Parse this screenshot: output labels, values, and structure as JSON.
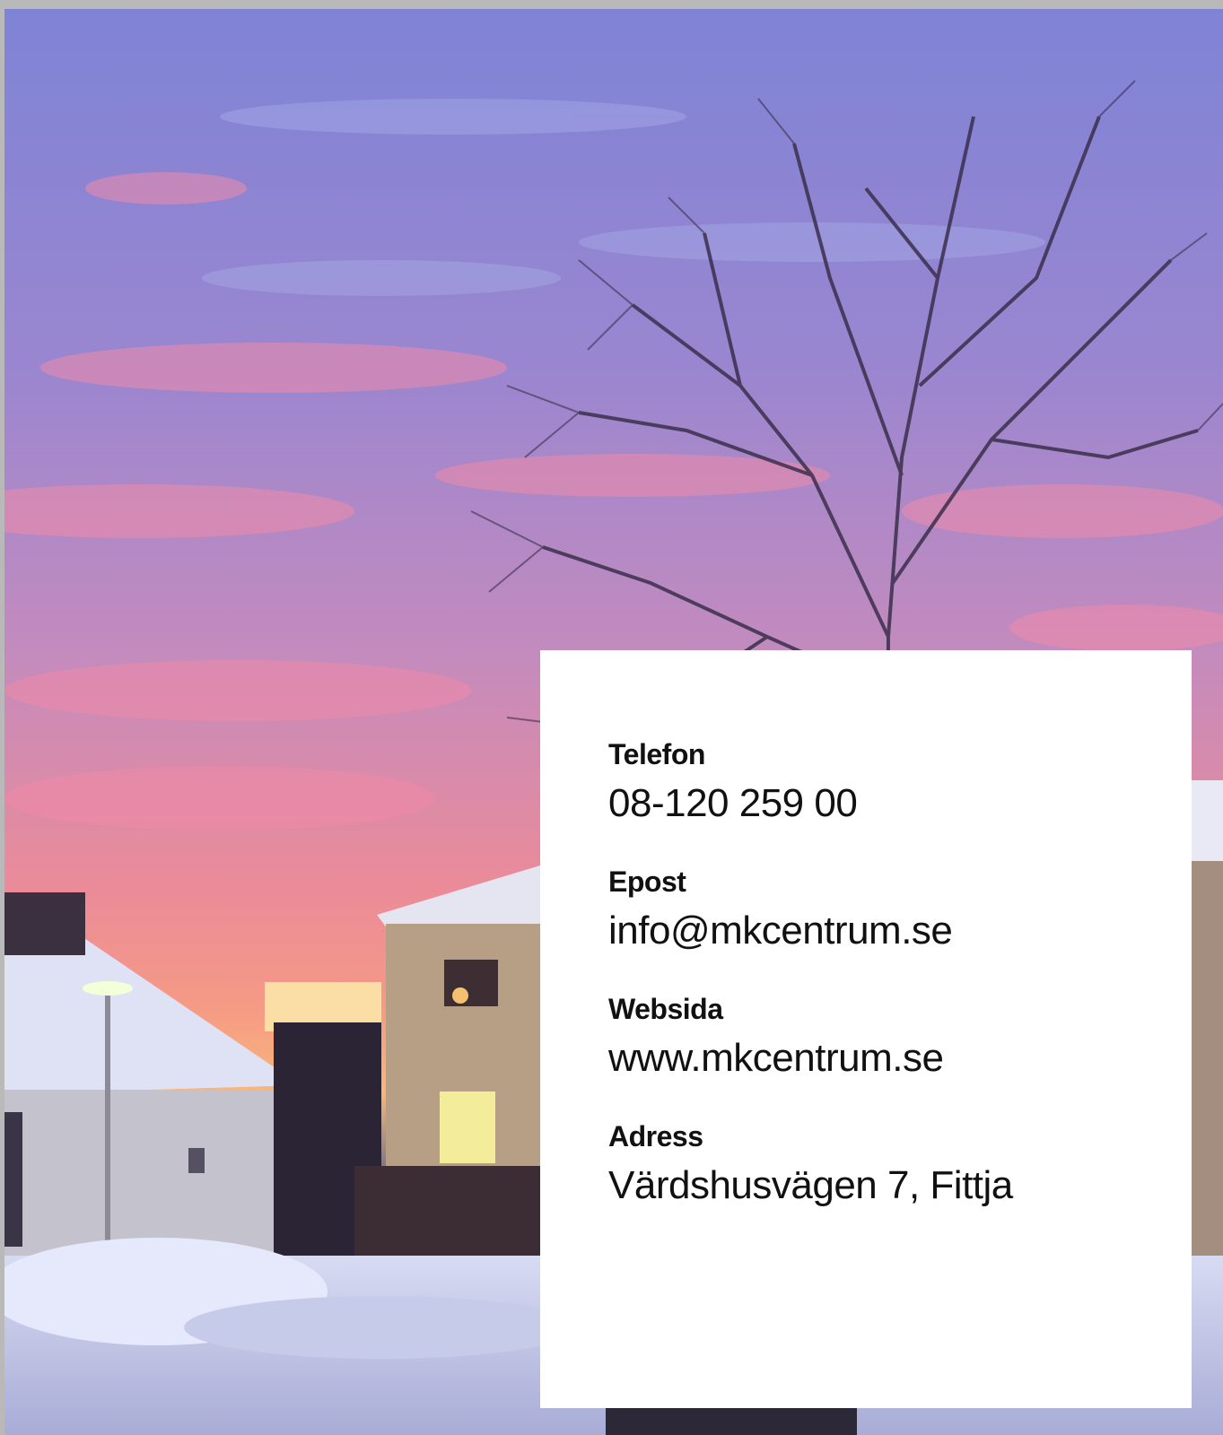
{
  "contact_card": {
    "items": [
      {
        "label": "Telefon",
        "value": "08-120 259 00"
      },
      {
        "label": "Epost",
        "value": "info@mkcentrum.se"
      },
      {
        "label": "Websida",
        "value": "www.mkcentrum.se"
      },
      {
        "label": "Adress",
        "value": "Värdshusvägen 7, Fittja"
      }
    ]
  },
  "colors": {
    "card_background": "#ffffff",
    "text": "#111111",
    "page_border": "#b9b9b9"
  }
}
